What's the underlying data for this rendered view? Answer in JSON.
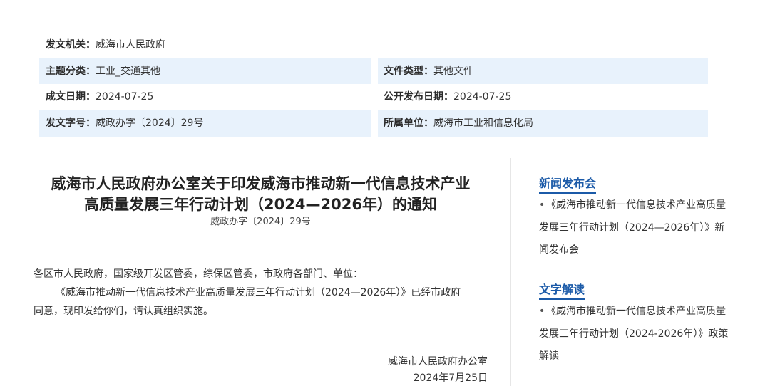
{
  "metadata": {
    "issuing_agency": {
      "label": "发文机关：",
      "value": "威海市人民政府"
    },
    "topic": {
      "label": "主题分类：",
      "value": "工业_交通其他"
    },
    "doc_type": {
      "label": "文件类型：",
      "value": "其他文件"
    },
    "written_date": {
      "label": "成文日期：",
      "value": "2024-07-25"
    },
    "publish_date": {
      "label": "公开发布日期：",
      "value": "2024-07-25"
    },
    "doc_number": {
      "label": "发文字号：",
      "value": "威政办字〔2024〕29号"
    },
    "unit": {
      "label": "所属单位：",
      "value": "威海市工业和信息化局"
    }
  },
  "article": {
    "title_lines": [
      "威海市人民政府办公室关于印发威海市推动新一代信息技术产业",
      "高质量发展三年行动计划（2024—2026年）的通知"
    ],
    "doc_number": "威政办字〔2024〕29号",
    "salutation": "各区市人民政府，国家级开发区管委，综保区管委，市政府各部门、单位：",
    "body_lines": [
      "《威海市推动新一代信息技术产业高质量发展三年行动计划（2024—2026年）》已经市政府",
      "同意，现印发给你们，请认真组织实施。"
    ],
    "signature": {
      "org": "威海市人民政府办公室",
      "date": "2024年7月25日"
    }
  },
  "sidebar": {
    "sections": [
      {
        "heading": "新闻发布会",
        "items": [
          {
            "lines": [
              "《威海市推动新一代信息技术产业高质量",
              "发展三年行动计划（2024—2026年）》新",
              "闻发布会"
            ]
          }
        ]
      },
      {
        "heading": "文字解读",
        "items": [
          {
            "lines": [
              "《威海市推动新一代信息技术产业高质量",
              "发展三年行动计划（2024-2026年）》政策",
              "解读"
            ]
          }
        ]
      }
    ]
  },
  "colors": {
    "accent": "#1b5aa8",
    "row_shade": "#e8f2fc",
    "text": "#333333",
    "divider": "#e6e6e6"
  }
}
